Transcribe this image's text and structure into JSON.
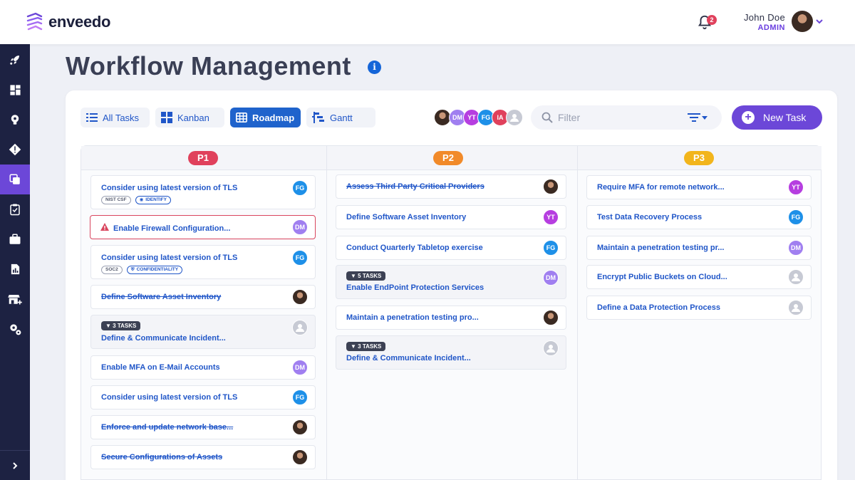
{
  "header": {
    "logo_text": "enveedo",
    "notification_count": "2",
    "user_name": "John Doe",
    "user_role": "ADMIN"
  },
  "page": {
    "title": "Workflow Management",
    "info_glyph": "i"
  },
  "views": {
    "all_tasks": "All Tasks",
    "kanban": "Kanban",
    "roadmap": "Roadmap",
    "gantt": "Gantt",
    "active": "Roadmap"
  },
  "assignees": [
    "DM",
    "YT",
    "FG",
    "IA"
  ],
  "filter": {
    "placeholder": "Filter"
  },
  "new_task_label": "New Task",
  "colors": {
    "accent": "#6c47d8",
    "link": "#2056c8",
    "p1": "#e0415c",
    "p2": "#f18a2a",
    "p3": "#f2b51c",
    "DM": "#a07ff0",
    "YT": "#b63ee0",
    "FG": "#1e90e8",
    "IA": "#e0415c"
  },
  "columns": [
    {
      "priority": "P1",
      "tasks": [
        {
          "title": "Consider using latest version of TLS",
          "assignee": "FG",
          "tags": [
            "NIST CSF",
            "IDENTIFY"
          ]
        },
        {
          "title": "Enable Firewall Configuration...",
          "assignee": "DM",
          "alert": true
        },
        {
          "title": "Consider using latest version of TLS",
          "assignee": "FG",
          "tags": [
            "SOC2",
            "CONFIDENTIALITY"
          ]
        },
        {
          "title": "Define Software Asset Inventory",
          "assignee": "photo",
          "struck": true
        },
        {
          "title": "Define & Communicate Incident...",
          "assignee": "none",
          "subtasks": "3 TASKS"
        },
        {
          "title": "Enable MFA on E-Mail Accounts",
          "assignee": "DM"
        },
        {
          "title": "Consider using latest version of TLS",
          "assignee": "FG"
        },
        {
          "title": "Enforce and update network base...",
          "assignee": "photo",
          "struck": true
        },
        {
          "title": "Secure Configurations of Assets",
          "assignee": "photo",
          "struck": true
        }
      ]
    },
    {
      "priority": "P2",
      "tasks": [
        {
          "title": "Assess Third Party Critical Providers",
          "assignee": "photo",
          "struck": true
        },
        {
          "title": "Define Software Asset Inventory",
          "assignee": "YT"
        },
        {
          "title": "Conduct Quarterly Tabletop exercise",
          "assignee": "FG"
        },
        {
          "title": "Enable EndPoint Protection Services",
          "assignee": "DM",
          "subtasks": "5 TASKS"
        },
        {
          "title": "Maintain a penetration testing pro...",
          "assignee": "photo"
        },
        {
          "title": "Define & Communicate Incident...",
          "assignee": "none",
          "subtasks": "3 TASKS"
        }
      ]
    },
    {
      "priority": "P3",
      "tasks": [
        {
          "title": "Require MFA for remote network...",
          "assignee": "YT"
        },
        {
          "title": "Test Data Recovery Process",
          "assignee": "FG"
        },
        {
          "title": "Maintain a penetration testing pr...",
          "assignee": "DM"
        },
        {
          "title": "Encrypt Public Buckets on Cloud...",
          "assignee": "none"
        },
        {
          "title": "Define a Data Protection Process",
          "assignee": "none"
        }
      ]
    }
  ]
}
